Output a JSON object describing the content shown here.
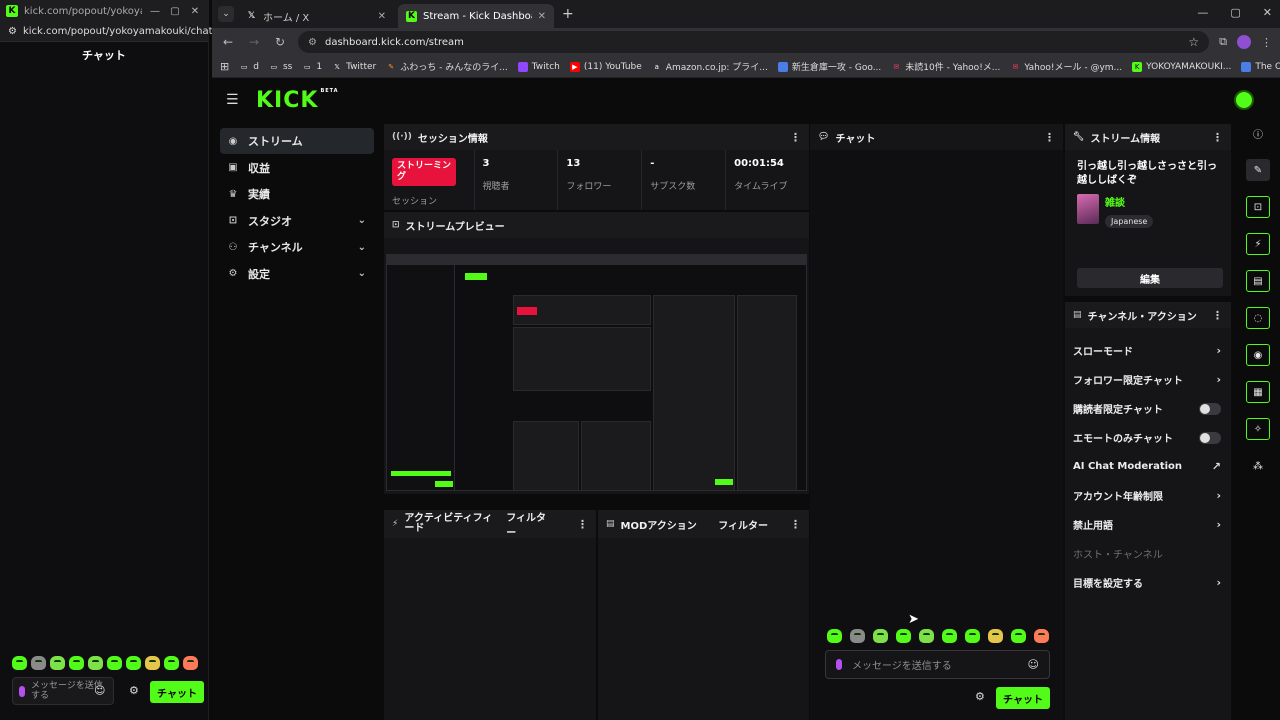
{
  "popout": {
    "title": "kick.com/popout/yokoya...",
    "url": "kick.com/popout/yokoyamakouki/chat",
    "chat_title": "チャット",
    "message_placeholder": "メッセージを送信する",
    "send_label": "チャット"
  },
  "browser": {
    "tabs": [
      {
        "label": "ホーム / X",
        "icon": "x-logo-icon"
      },
      {
        "label": "Stream - Kick Dashboard",
        "icon": "kick-logo-icon"
      }
    ],
    "url": "dashboard.kick.com/stream",
    "bookmarks": [
      {
        "label": "d"
      },
      {
        "label": "ss"
      },
      {
        "label": "1"
      },
      {
        "label": "Twitter"
      },
      {
        "label": "ふわっち - みんなのライ..."
      },
      {
        "label": "Twitch"
      },
      {
        "label": "(11) YouTube"
      },
      {
        "label": "Amazon.co.jp: プライ..."
      },
      {
        "label": "新生倉庫一攻 - Goo..."
      },
      {
        "label": "未読10件 - Yahoo!メ..."
      },
      {
        "label": "Yahoo!メール - @ym..."
      },
      {
        "label": "YOKOYAMAKOUKI..."
      },
      {
        "label": "The Old Realms Ma..."
      }
    ]
  },
  "dashboard": {
    "logo": "KICK",
    "logo_badge": "BETA",
    "nav": [
      {
        "label": "ストリーム",
        "icon": "broadcast-icon"
      },
      {
        "label": "収益",
        "icon": "revenue-icon"
      },
      {
        "label": "実績",
        "icon": "trophy-icon"
      },
      {
        "label": "スタジオ",
        "icon": "studio-icon"
      },
      {
        "label": "チャンネル",
        "icon": "channel-icon"
      },
      {
        "label": "設定",
        "icon": "gear-icon"
      }
    ],
    "session": {
      "title": "セッション情報",
      "status": "ストリーミング",
      "status_label": "セッション",
      "stats": [
        {
          "value": "3",
          "label": "視聴者"
        },
        {
          "value": "13",
          "label": "フォロワー"
        },
        {
          "value": "-",
          "label": "サブスク数"
        },
        {
          "value": "00:01:54",
          "label": "タイムライブ"
        }
      ]
    },
    "preview": {
      "title": "ストリームプレビュー"
    },
    "activity": {
      "title": "アクティビティフィード",
      "filter": "フィルター"
    },
    "mod": {
      "title": "MODアクション",
      "filter": "フィルター"
    },
    "chat": {
      "title": "チャット",
      "placeholder": "メッセージを送信する",
      "send_label": "チャット"
    },
    "stream_info": {
      "title": "ストリーム情報",
      "stream_title": "引っ越し引っ越しさっさと引っ越ししばくぞ",
      "category": "雑談",
      "language": "Japanese",
      "edit_label": "編集"
    },
    "channel_actions": {
      "title": "チャンネル・アクション",
      "items": [
        {
          "label": "スローモード",
          "control": "chevron"
        },
        {
          "label": "フォロワー限定チャット",
          "control": "chevron"
        },
        {
          "label": "購読者限定チャット",
          "control": "toggle"
        },
        {
          "label": "エモートのみチャット",
          "control": "toggle"
        },
        {
          "label": "AI Chat Moderation",
          "control": "external"
        },
        {
          "label": "アカウント年齢制限",
          "control": "chevron"
        },
        {
          "label": "禁止用語",
          "control": "chevron"
        },
        {
          "label": "ホスト・チャンネル",
          "control": "none"
        },
        {
          "label": "目標を設定する",
          "control": "chevron"
        }
      ]
    }
  },
  "colors": {
    "brand": "#53fc18",
    "live": "#e8133c",
    "panel": "#151517",
    "background": "#0b0b0c"
  }
}
